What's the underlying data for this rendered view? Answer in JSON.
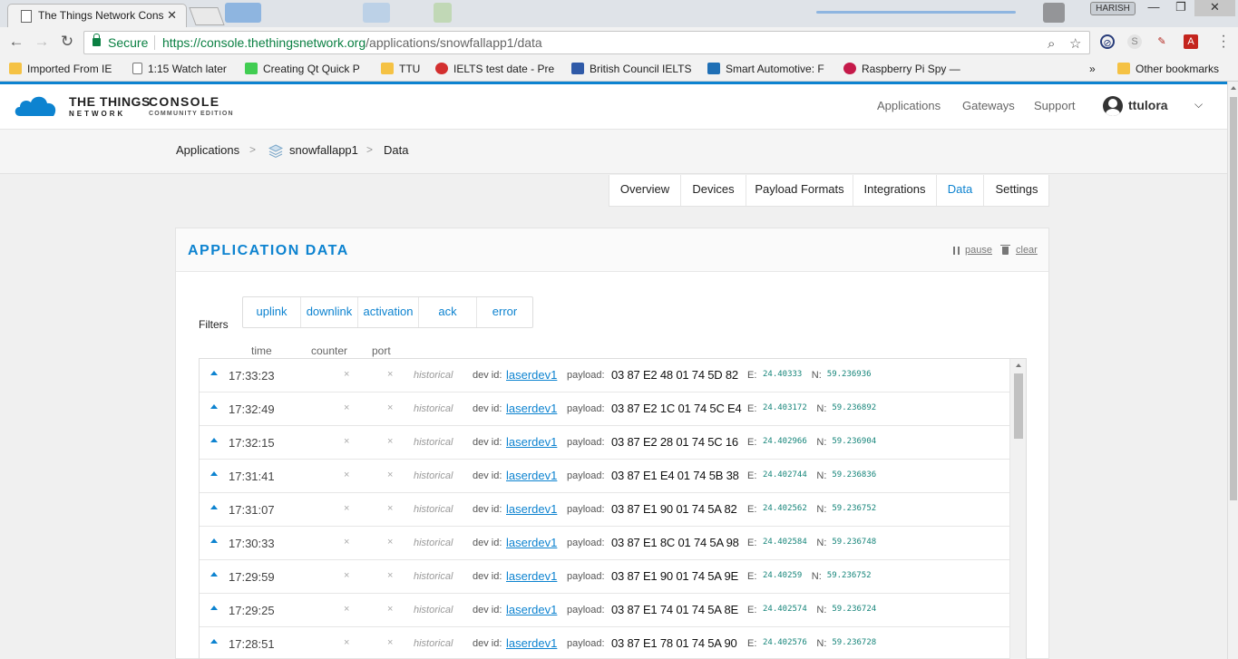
{
  "browser": {
    "tab_title": "The Things Network Cons",
    "profile": "HARISH",
    "secure_label": "Secure",
    "url_host": "https://console.thethingsnetwork.org",
    "url_path": "/applications/snowfallapp1/data",
    "bookmarks": [
      {
        "label": "Imported From IE",
        "icon": "folder-icon"
      },
      {
        "label": "1:15 Watch later",
        "icon": "page-icon"
      },
      {
        "label": "Creating Qt Quick P",
        "icon": "qt-icon"
      },
      {
        "label": "TTU",
        "icon": "folder-icon"
      },
      {
        "label": "IELTS test date - Pre",
        "icon": "ielts-icon"
      },
      {
        "label": "British Council IELTS",
        "icon": "ors-icon"
      },
      {
        "label": "Smart Automotive: F",
        "icon": "automotive-icon"
      },
      {
        "label": "Raspberry Pi Spy —",
        "icon": "raspberry-icon"
      },
      {
        "label": "Other bookmarks",
        "icon": "folder-icon"
      }
    ],
    "overflow_label": "»"
  },
  "header": {
    "logo_line1": "THE THINGS",
    "logo_line2": "NETWORK",
    "console_line1": "CONSOLE",
    "console_line2": "COMMUNITY EDITION",
    "nav": [
      "Applications",
      "Gateways",
      "Support"
    ],
    "username": "ttulora"
  },
  "breadcrumb": {
    "items": [
      "Applications",
      "snowfallapp1",
      "Data"
    ],
    "separator": ">"
  },
  "app_nav": {
    "items": [
      "Overview",
      "Devices",
      "Payload Formats",
      "Integrations",
      "Data",
      "Settings"
    ],
    "active": "Data"
  },
  "panel": {
    "title": "APPLICATION DATA",
    "pause_label": "pause",
    "clear_label": "clear",
    "filters_label": "Filters",
    "filters": [
      "uplink",
      "downlink",
      "activation",
      "ack",
      "error"
    ],
    "columns": [
      "time",
      "counter",
      "port"
    ],
    "dev_id_label": "dev id:",
    "payload_label": "payload:",
    "e_label": "E:",
    "n_label": "N:",
    "historical_label": "historical",
    "empty_mark": "×",
    "rows": [
      {
        "time": "17:33:23",
        "dev": "laserdev1",
        "payload": "03 87 E2 48 01 74 5D 82",
        "e": "24.40333",
        "n": "59.236936"
      },
      {
        "time": "17:32:49",
        "dev": "laserdev1",
        "payload": "03 87 E2 1C 01 74 5C E4",
        "e": "24.403172",
        "n": "59.236892"
      },
      {
        "time": "17:32:15",
        "dev": "laserdev1",
        "payload": "03 87 E2 28 01 74 5C 16",
        "e": "24.402966",
        "n": "59.236904"
      },
      {
        "time": "17:31:41",
        "dev": "laserdev1",
        "payload": "03 87 E1 E4 01 74 5B 38",
        "e": "24.402744",
        "n": "59.236836"
      },
      {
        "time": "17:31:07",
        "dev": "laserdev1",
        "payload": "03 87 E1 90 01 74 5A 82",
        "e": "24.402562",
        "n": "59.236752"
      },
      {
        "time": "17:30:33",
        "dev": "laserdev1",
        "payload": "03 87 E1 8C 01 74 5A 98",
        "e": "24.402584",
        "n": "59.236748"
      },
      {
        "time": "17:29:59",
        "dev": "laserdev1",
        "payload": "03 87 E1 90 01 74 5A 9E",
        "e": "24.40259",
        "n": "59.236752"
      },
      {
        "time": "17:29:25",
        "dev": "laserdev1",
        "payload": "03 87 E1 74 01 74 5A 8E",
        "e": "24.402574",
        "n": "59.236724"
      },
      {
        "time": "17:28:51",
        "dev": "laserdev1",
        "payload": "03 87 E1 78 01 74 5A 90",
        "e": "24.402576",
        "n": "59.236728"
      }
    ]
  },
  "colors": {
    "accent": "#0d83d0",
    "coordinate": "#16857a",
    "secure": "#0b8043"
  }
}
